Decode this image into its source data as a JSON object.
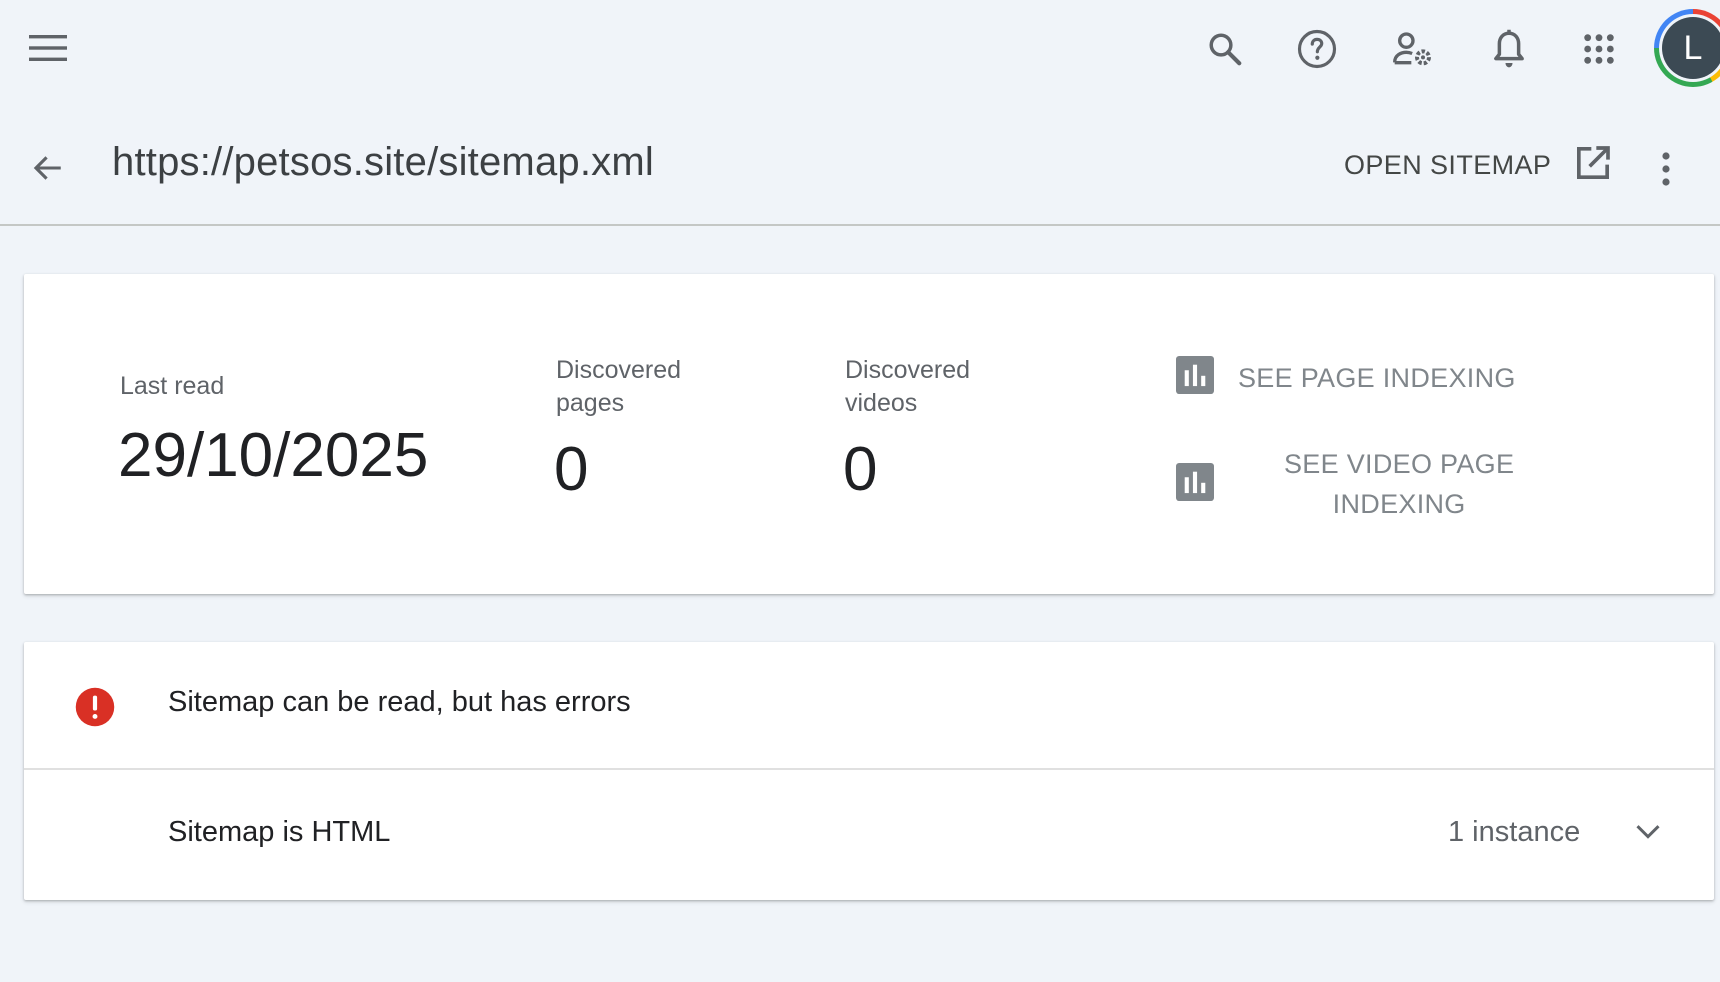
{
  "header": {
    "menu_icon": "menu-icon",
    "actions": [
      {
        "name": "search",
        "icon": "search-icon"
      },
      {
        "name": "help",
        "icon": "help-icon"
      },
      {
        "name": "users-settings",
        "icon": "manage-accounts-icon"
      },
      {
        "name": "notifications",
        "icon": "bell-icon"
      },
      {
        "name": "apps",
        "icon": "apps-grid-icon"
      }
    ],
    "avatar_initial": "L"
  },
  "title_row": {
    "back_icon": "arrow-back-icon",
    "title": "https://petsos.site/sitemap.xml",
    "open_sitemap_label": "OPEN SITEMAP",
    "open_icon": "open-in-new-icon",
    "more_icon": "more-vert-icon"
  },
  "stats": {
    "last_read_label": "Last read",
    "last_read_value": "29/10/2025",
    "discovered_pages_label_1": "Discovered",
    "discovered_pages_label_2": "pages",
    "discovered_pages_value": "0",
    "discovered_videos_label_1": "Discovered",
    "discovered_videos_label_2": "videos",
    "discovered_videos_value": "0",
    "see_page_indexing_label": "SEE PAGE INDEXING",
    "see_video_page_indexing_label_1": "SEE VIDEO PAGE",
    "see_video_page_indexing_label_2": "INDEXING",
    "chart_icon": "bar-chart-icon"
  },
  "errors": {
    "status_icon": "error-icon",
    "status_color": "#d93025",
    "title": "Sitemap can be read, but has errors",
    "issues": [
      {
        "title": "Sitemap is HTML",
        "count": "1 instance",
        "icon": "chevron-down-icon"
      }
    ]
  }
}
